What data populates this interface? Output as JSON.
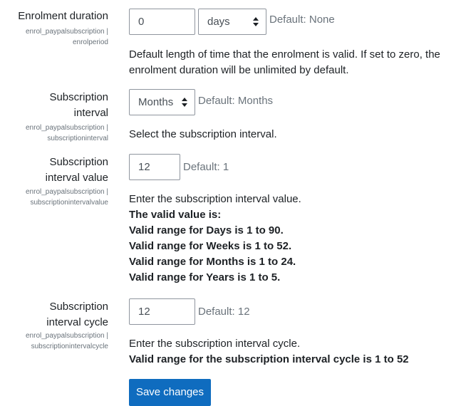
{
  "enrolment_duration": {
    "label": "Enrolment duration",
    "setting_line1": "enrol_paypalsubscription |",
    "setting_line2": "enrolperiod",
    "value": "0",
    "unit": "days",
    "default": "Default: None",
    "desc_line1": "Default length of time that the enrolment is valid. If set to zero, the",
    "desc_line2": "enrolment duration will be unlimited by default."
  },
  "subscription_interval": {
    "label_line1": "Subscription",
    "label_line2": "interval",
    "setting_line1": "enrol_paypalsubscription |",
    "setting_line2": "subscriptioninterval",
    "value": "Months",
    "default": "Default: Months",
    "desc": "Select the subscription interval."
  },
  "subscription_interval_value": {
    "label_line1": "Subscription",
    "label_line2": "interval value",
    "setting_line1": "enrol_paypalsubscription |",
    "setting_line2": "subscriptionintervalvalue",
    "value": "12",
    "default": "Default: 1",
    "desc": "Enter the subscription interval value.",
    "bold_lines": [
      "The valid value is:",
      "Valid range for Days is 1 to 90.",
      "Valid range for Weeks is 1 to 52.",
      "Valid range for Months is 1 to 24.",
      "Valid range for Years is 1 to 5."
    ]
  },
  "subscription_interval_cycle": {
    "label_line1": "Subscription",
    "label_line2": "interval cycle",
    "setting_line1": "enrol_paypalsubscription |",
    "setting_line2": "subscriptionintervalcycle",
    "value": "12",
    "default": "Default: 12",
    "desc": "Enter the subscription interval cycle.",
    "bold": "Valid range for the subscription interval cycle is 1 to 52"
  },
  "save_button": "Save changes",
  "colors": {
    "primary": "#0f6cbf",
    "muted": "#6a737b",
    "border": "#8f959e"
  }
}
